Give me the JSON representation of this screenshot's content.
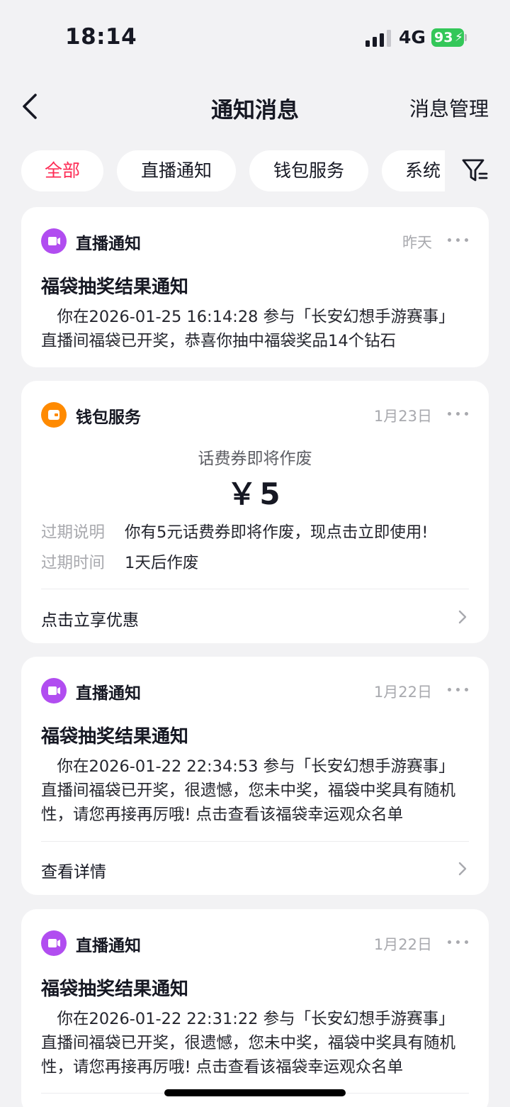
{
  "status_bar": {
    "time": "18:14",
    "network": "4G",
    "battery": "93"
  },
  "nav": {
    "title": "通知消息",
    "manage_label": "消息管理"
  },
  "tabs": [
    {
      "label": "全部",
      "active": true
    },
    {
      "label": "直播通知",
      "active": false
    },
    {
      "label": "钱包服务",
      "active": false
    },
    {
      "label": "系统",
      "active": false
    }
  ],
  "cards": [
    {
      "category": "直播通知",
      "date": "昨天",
      "title": "福袋抽奖结果通知",
      "body": "你在2026-01-25 16:14:28 参与「长安幻想手游赛事」直播间福袋已开奖，恭喜你抽中福袋奖品14个钻石"
    },
    {
      "category": "钱包服务",
      "date": "1月23日",
      "coupon_title": "话费券即将作废",
      "coupon_amount": "￥5",
      "rows": [
        {
          "key": "过期说明",
          "value": "你有5元话费券即将作废，现点击立即使用!"
        },
        {
          "key": "过期时间",
          "value": "1天后作废"
        }
      ],
      "action": "点击立享优惠"
    },
    {
      "category": "直播通知",
      "date": "1月22日",
      "title": "福袋抽奖结果通知",
      "body": "你在2026-01-22 22:34:53 参与「长安幻想手游赛事」直播间福袋已开奖，很遗憾，您未中奖，福袋中奖具有随机性，请您再接再厉哦! 点击查看该福袋幸运观众名单",
      "action": "查看详情"
    },
    {
      "category": "直播通知",
      "date": "1月22日",
      "title": "福袋抽奖结果通知",
      "body": "你在2026-01-22 22:31:22 参与「长安幻想手游赛事」直播间福袋已开奖，很遗憾，您未中奖，福袋中奖具有随机性，请您再接再厉哦! 点击查看该福袋幸运观众名单"
    }
  ],
  "colors": {
    "accent": "#fe2c55",
    "live_icon": "#b14df0",
    "wallet_icon": "#ff8a00",
    "battery": "#34c759"
  }
}
